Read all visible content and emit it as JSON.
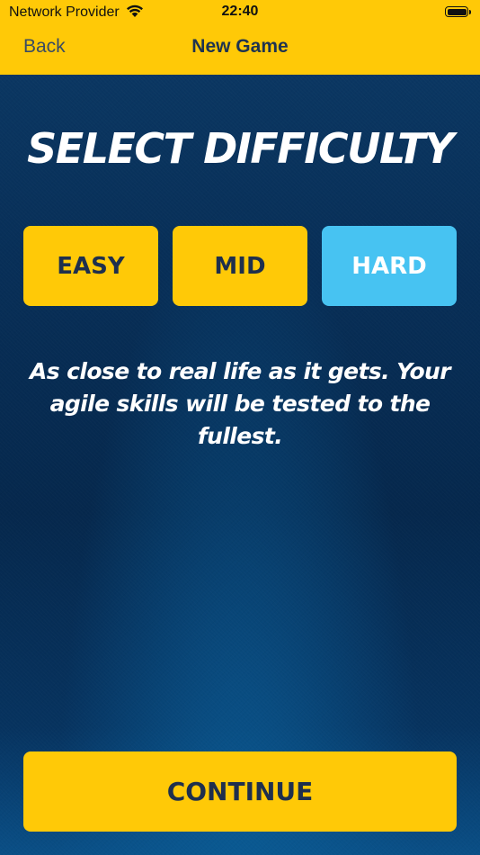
{
  "status_bar": {
    "carrier": "Network Provider",
    "time": "22:40",
    "wifi_icon": "wifi-icon",
    "battery_icon": "battery-icon"
  },
  "nav": {
    "back_label": "Back",
    "title": "New Game"
  },
  "main": {
    "heading": "SELECT DIFFICULTY",
    "difficulties": [
      {
        "label": "EASY",
        "selected": false
      },
      {
        "label": "MID",
        "selected": false
      },
      {
        "label": "HARD",
        "selected": true
      }
    ],
    "description": "As close to real life as it gets. Your agile skills will be tested to the fullest.",
    "continue_label": "CONTINUE"
  },
  "colors": {
    "accent_yellow": "#ffc907",
    "selected_blue": "#47c3f2",
    "dark_text": "#1e2f4d",
    "background_navy": "#062a52"
  }
}
